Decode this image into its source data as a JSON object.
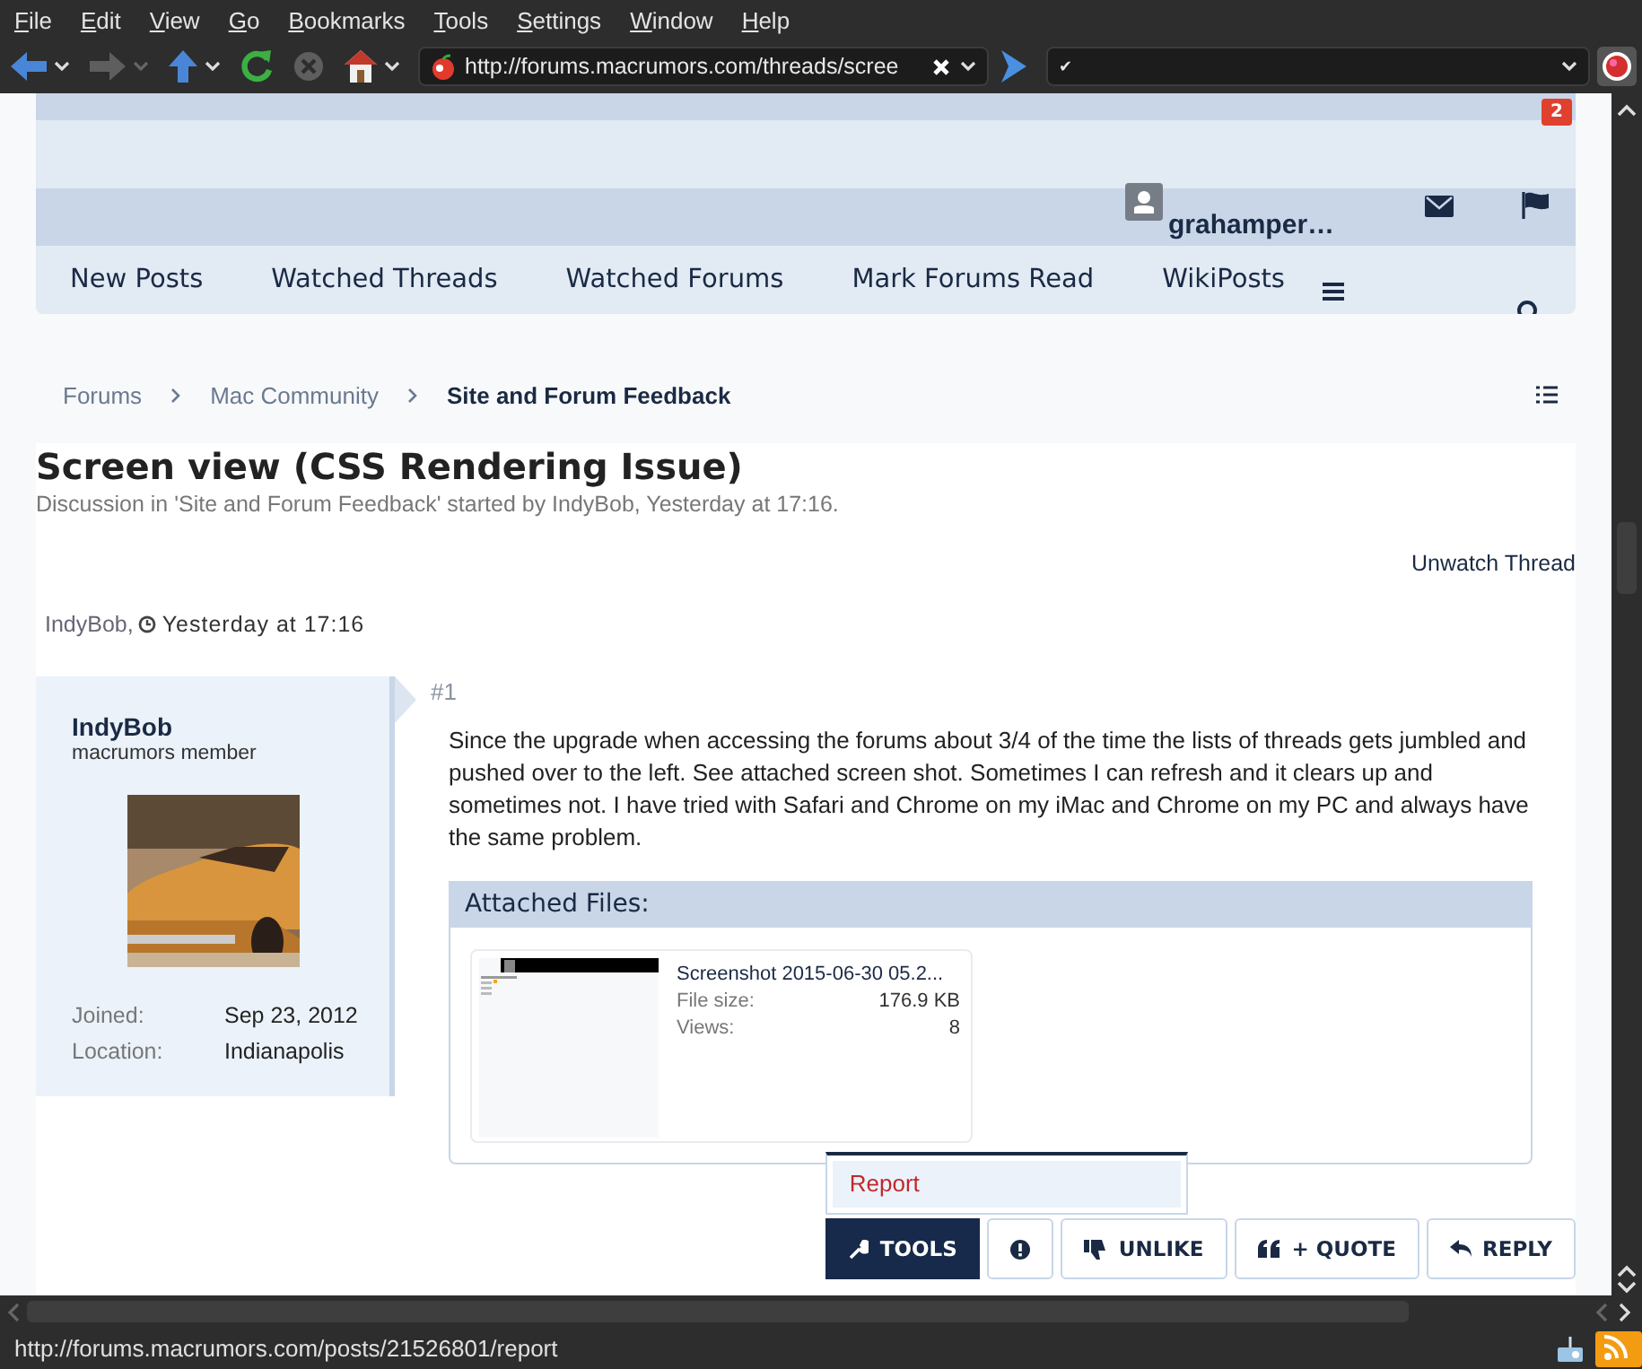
{
  "menu": [
    "File",
    "Edit",
    "View",
    "Go",
    "Bookmarks",
    "Tools",
    "Settings",
    "Window",
    "Help"
  ],
  "toolbar": {
    "buttons": [
      {
        "kind": "back",
        "disabled": false,
        "dropdown": true
      },
      {
        "kind": "forward",
        "disabled": true,
        "dropdown": true
      },
      {
        "kind": "up",
        "disabled": false,
        "dropdown": true
      },
      {
        "kind": "reload",
        "disabled": false,
        "dropdown": false
      },
      {
        "kind": "stop",
        "disabled": true,
        "dropdown": false
      },
      {
        "kind": "home",
        "disabled": false,
        "dropdown": true
      }
    ],
    "address": "http://forums.macrumors.com/threads/scree",
    "search": "✔"
  },
  "header": {
    "alert_count": "2",
    "username": "grahamper…"
  },
  "nav": [
    {
      "label": "New Posts"
    },
    {
      "label": "Watched Threads"
    },
    {
      "label": "Watched Forums"
    },
    {
      "label": "Mark Forums Read"
    },
    {
      "label": "WikiPosts"
    }
  ],
  "breadcrumbs": [
    {
      "label": "Forums",
      "current": false
    },
    {
      "label": "Mac Community",
      "current": false
    },
    {
      "label": "Site and Forum Feedback",
      "current": true
    }
  ],
  "thread": {
    "title": "Screen view (CSS Rendering Issue)",
    "description": "Discussion in 'Site and Forum Feedback' started by IndyBob, Yesterday at 17:16.",
    "watch_link": "Unwatch Thread"
  },
  "post": {
    "author": "IndyBob,",
    "time": "Yesterday at 17:16",
    "number": "#1",
    "user": {
      "name": "IndyBob",
      "title": "macrumors member",
      "stats": [
        {
          "label": "Joined:",
          "value": "Sep 23, 2012"
        },
        {
          "label": "Location:",
          "value": "Indianapolis"
        }
      ]
    },
    "body": "Since the upgrade when accessing the forums about 3/4 of the time the lists of threads gets jumbled and pushed over to the left. See attached screen shot. Sometimes I can refresh and it clears up and sometimes not. I have tried with Safari and Chrome on my iMac and Chrome on my PC and always have the same problem.",
    "attachments": {
      "heading": "Attached Files:",
      "files": [
        {
          "name": "Screenshot 2015-06-30 05.2...",
          "stats": [
            {
              "label": "File size:",
              "value": "176.9 KB"
            },
            {
              "label": "Views:",
              "value": "8"
            }
          ]
        }
      ]
    },
    "tools_menu": [
      {
        "label": "Report"
      }
    ],
    "buttons": [
      {
        "kind": "tools",
        "label": "TOOLS",
        "expanded": true
      },
      {
        "kind": "report"
      },
      {
        "kind": "unlike",
        "label": "UNLIKE"
      },
      {
        "kind": "quote",
        "label": "+ QUOTE"
      },
      {
        "kind": "reply",
        "label": "REPLY"
      }
    ]
  },
  "status_bar": {
    "text": "http://forums.macrumors.com/posts/21526801/report"
  }
}
